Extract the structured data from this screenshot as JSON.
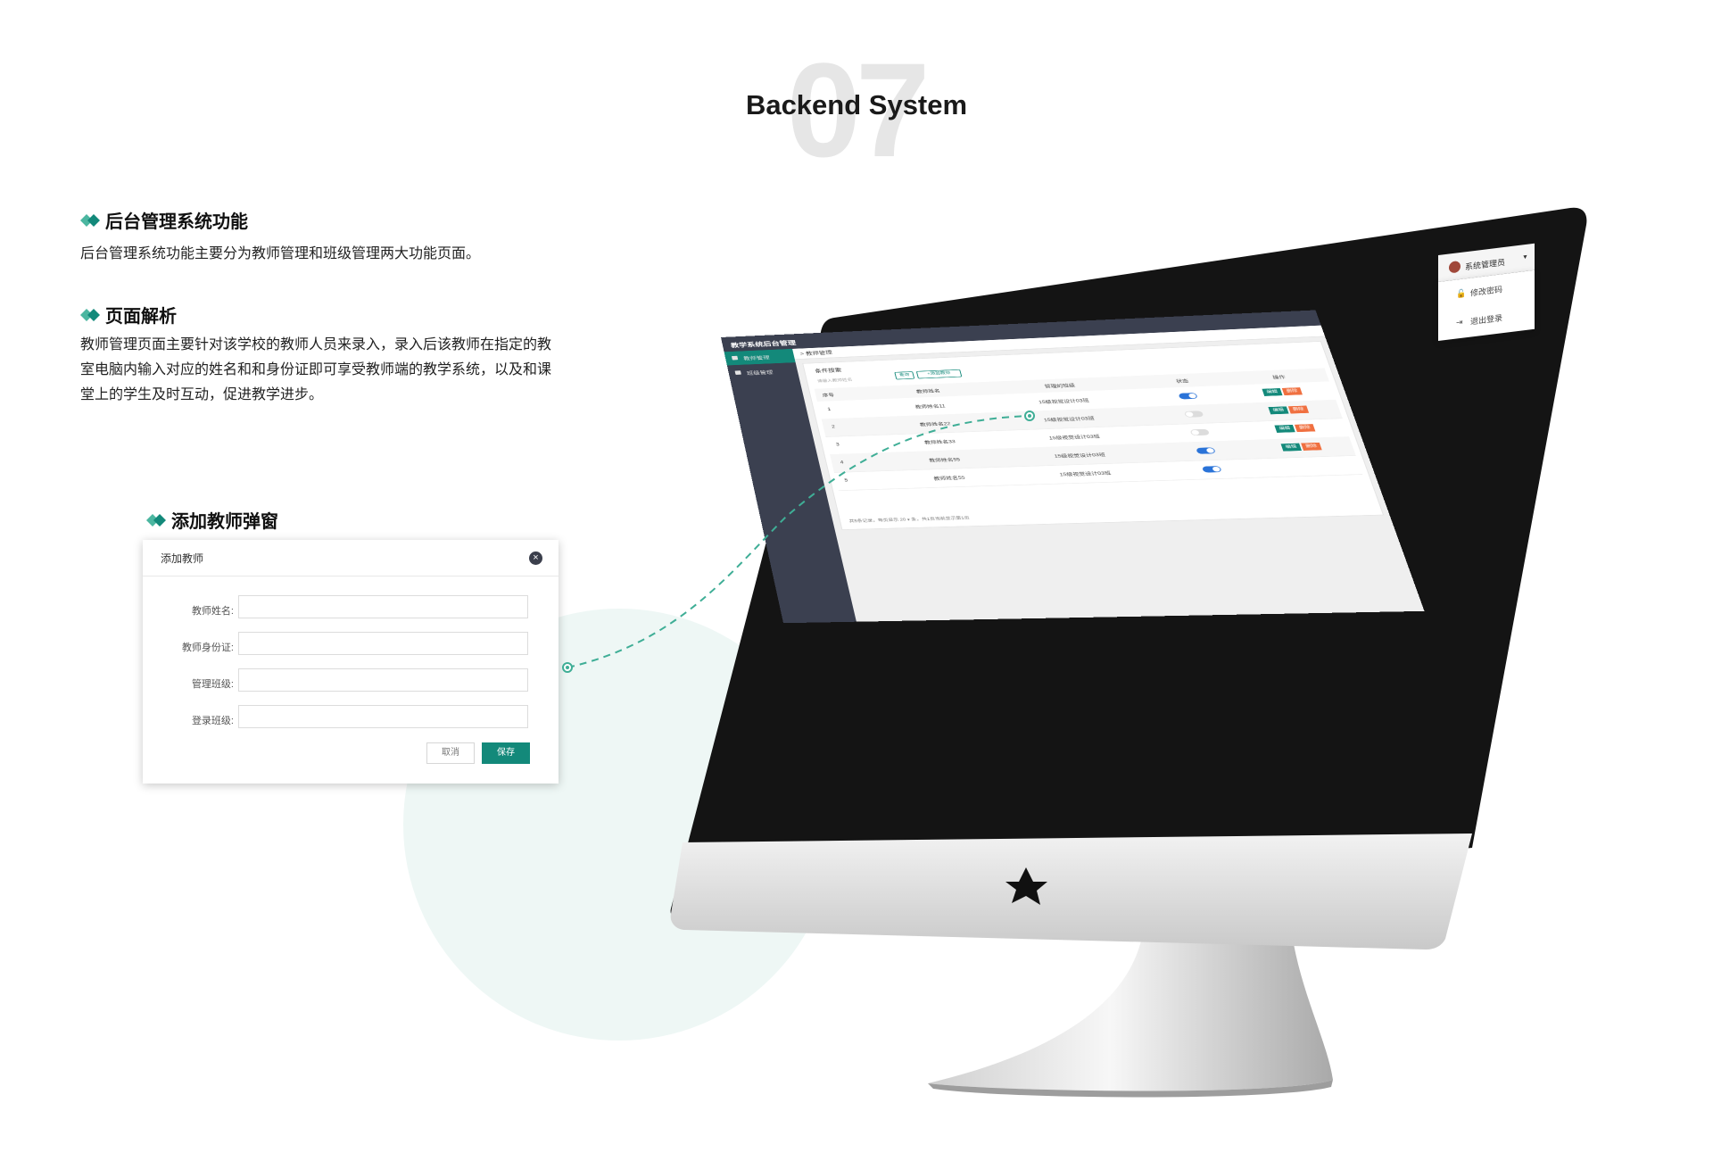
{
  "header": {
    "number": "07",
    "title": "Backend System"
  },
  "sections": [
    {
      "heading": "后台管理系统功能",
      "body": "后台管理系统功能主要分为教师管理和班级管理两大功能页面。"
    },
    {
      "heading": "页面解析",
      "lines": [
        "教师管理页面主要针对该学校的教师人员来录入，录入后该教师在指定的教",
        "室电脑内输入对应的姓名和和身份证即可享受教师端的教学系统，以及和课",
        "堂上的学生及时互动，促进教学进步。"
      ]
    },
    {
      "heading": "添加教师弹窗"
    }
  ],
  "modal": {
    "title": "添加教师",
    "fields": [
      {
        "label": "教师姓名:",
        "value": ""
      },
      {
        "label": "教师身份证:",
        "value": ""
      },
      {
        "label": "管理班级:",
        "value": ""
      },
      {
        "label": "登录班级:",
        "value": ""
      }
    ],
    "cancel": "取消",
    "save": "保存"
  },
  "app": {
    "title": "教学系统后台管理",
    "sidebar": [
      {
        "label": "教师管理",
        "active": true
      },
      {
        "label": "班级管理",
        "active": false
      }
    ],
    "breadcrumb": "> 教师管理",
    "search": {
      "label": "条件搜索",
      "placeholder": "请输入教师姓名",
      "search_button": "查询",
      "add_button": "+添加教师"
    },
    "table": {
      "headers": [
        "序号",
        "教师姓名",
        "管理的班级",
        "状态",
        "操作"
      ],
      "rows": [
        {
          "index": "1",
          "name": "教师姓名11",
          "class": "15级视觉设计03班",
          "status": true
        },
        {
          "index": "2",
          "name": "教师姓名22",
          "class": "15级视觉设计03班",
          "status": false
        },
        {
          "index": "3",
          "name": "教师姓名33",
          "class": "15级视觉设计03班",
          "status": false
        },
        {
          "index": "4",
          "name": "教师姓名55",
          "class": "15级视觉设计03班",
          "status": true
        },
        {
          "index": "5",
          "name": "教师姓名55",
          "class": "15级视觉设计03班",
          "status": true
        }
      ],
      "edit": "编辑",
      "delete": "删除"
    },
    "pager": "共5条记录，每页显示 20 ▾ 条，共1页当前显示第1页",
    "user": {
      "name": "系统管理员",
      "menu": [
        "修改密码",
        "退出登录"
      ]
    }
  },
  "colors": {
    "accent": "#13897a",
    "accent_light": "#4bb6a0",
    "danger": "#f07040",
    "toggle_on": "#2a73d8",
    "sidebar": "#3b4050"
  },
  "icons": [
    "diamond-icon",
    "close-icon",
    "user-icon",
    "class-icon",
    "lock-icon",
    "logout-icon",
    "star-logo-icon"
  ]
}
